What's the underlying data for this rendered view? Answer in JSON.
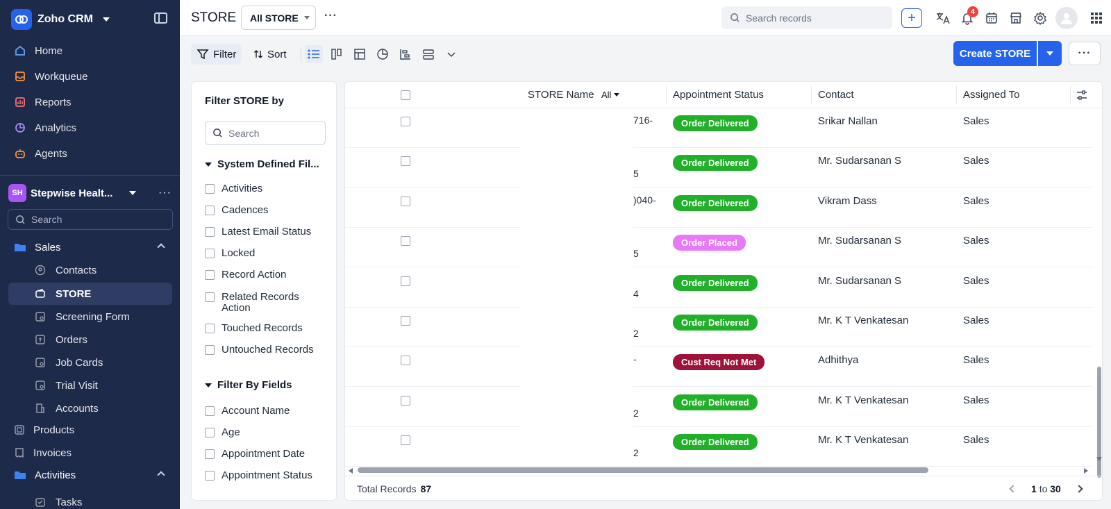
{
  "app": {
    "name": "Zoho CRM"
  },
  "sidebar": {
    "main_nav": [
      {
        "label": "Home",
        "icon": "home-icon"
      },
      {
        "label": "Workqueue",
        "icon": "workqueue-icon"
      },
      {
        "label": "Reports",
        "icon": "reports-icon"
      },
      {
        "label": "Analytics",
        "icon": "analytics-icon"
      },
      {
        "label": "Agents",
        "icon": "agents-icon"
      }
    ],
    "workspace": {
      "initials": "SH",
      "name": "Stepwise Healt..."
    },
    "search_placeholder": "Search",
    "groups": [
      {
        "label": "Sales",
        "items": [
          {
            "label": "Contacts"
          },
          {
            "label": "STORE",
            "active": true
          },
          {
            "label": "Screening Form"
          },
          {
            "label": "Orders"
          },
          {
            "label": "Job Cards"
          },
          {
            "label": "Trial Visit"
          },
          {
            "label": "Accounts"
          }
        ]
      }
    ],
    "extra_nav": [
      {
        "label": "Products"
      },
      {
        "label": "Invoices"
      }
    ],
    "activities_group": {
      "label": "Activities",
      "items": [
        {
          "label": "Tasks"
        }
      ]
    }
  },
  "header": {
    "title": "STORE",
    "view_select": "All STORE",
    "search_placeholder": "Search records",
    "notification_count": "4"
  },
  "toolbar": {
    "filter_label": "Filter",
    "sort_label": "Sort",
    "create_label": "Create STORE"
  },
  "filter_panel": {
    "title": "Filter STORE by",
    "search_placeholder": "Search",
    "system_section": "System Defined Fil...",
    "system_items": [
      "Activities",
      "Cadences",
      "Latest Email Status",
      "Locked",
      "Record Action",
      "Related Records Action",
      "Touched Records",
      "Untouched Records"
    ],
    "fields_section": "Filter By Fields",
    "field_items": [
      "Account Name",
      "Age",
      "Appointment Date",
      "Appointment Status"
    ]
  },
  "table": {
    "columns": {
      "store_name": "STORE Name",
      "all_filter": "All",
      "appointment_status": "Appointment Status",
      "contact": "Contact",
      "assigned_to": "Assigned To"
    },
    "status_colors": {
      "Order Delivered": "#22b02b",
      "Order Placed": "#e879f9",
      "Cust Req Not Met": "#9f1239"
    },
    "rows": [
      {
        "name_fragment": "716-",
        "name_pos": "top",
        "status": "Order Delivered",
        "contact": "Srikar Nallan",
        "assigned": "Sales"
      },
      {
        "name_fragment": "5",
        "name_pos": "bottom",
        "status": "Order Delivered",
        "contact": "Mr. Sudarsanan S",
        "assigned": "Sales"
      },
      {
        "name_fragment": ")040-",
        "name_pos": "top",
        "status": "Order Delivered",
        "contact": "Vikram Dass",
        "assigned": "Sales"
      },
      {
        "name_fragment": "5",
        "name_pos": "bottom",
        "status": "Order Placed",
        "contact": "Mr. Sudarsanan S",
        "assigned": "Sales"
      },
      {
        "name_fragment": "4",
        "name_pos": "bottom",
        "status": "Order Delivered",
        "contact": "Mr. Sudarsanan S",
        "assigned": "Sales"
      },
      {
        "name_fragment": "2",
        "name_pos": "bottom",
        "status": "Order Delivered",
        "contact": "Mr. K T Venkatesan",
        "assigned": "Sales"
      },
      {
        "name_fragment": "-",
        "name_pos": "top",
        "status": "Cust Req Not Met",
        "contact": "Adhithya",
        "assigned": "Sales"
      },
      {
        "name_fragment": "2",
        "name_pos": "bottom",
        "status": "Order Delivered",
        "contact": "Mr. K T Venkatesan",
        "assigned": "Sales"
      },
      {
        "name_fragment": "2",
        "name_pos": "bottom",
        "status": "Order Delivered",
        "contact": "Mr. K T Venkatesan",
        "assigned": "Sales"
      }
    ],
    "footer": {
      "total_label": "Total Records",
      "total_count": "87",
      "range_start": "1",
      "range_to": "to",
      "range_end": "30"
    }
  }
}
